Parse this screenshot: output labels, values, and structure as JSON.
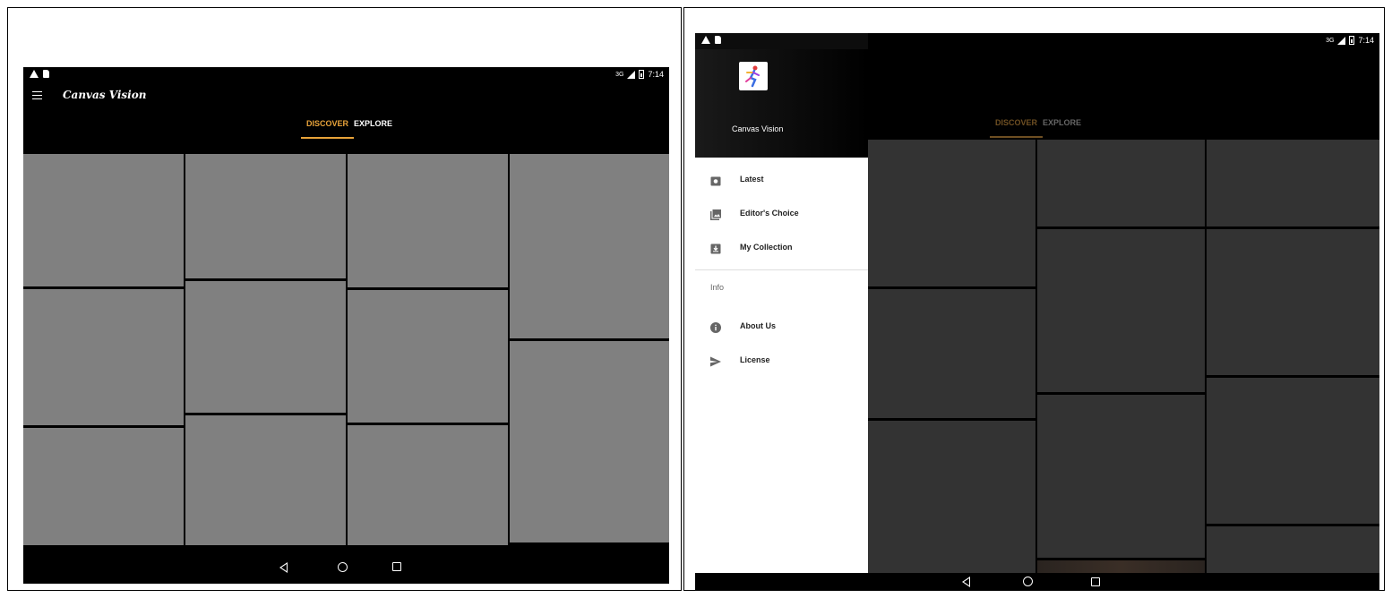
{
  "status": {
    "time": "7:14",
    "network": "3G"
  },
  "app": {
    "title": "Canvas Vision"
  },
  "tabs": [
    {
      "label": "DISCOVER",
      "active": true
    },
    {
      "label": "EXPLORE",
      "active": false
    }
  ],
  "drawer": {
    "title": "Canvas Vision",
    "items": [
      {
        "label": "Latest",
        "icon": "camera-icon"
      },
      {
        "label": "Editor's Choice",
        "icon": "photo-library-icon"
      },
      {
        "label": "My Collection",
        "icon": "download-box-icon"
      }
    ],
    "section_label": "Info",
    "info_items": [
      {
        "label": "About Us",
        "icon": "info-icon"
      },
      {
        "label": "License",
        "icon": "send-icon"
      }
    ]
  },
  "colors": {
    "accent": "#e8a33a",
    "tile_placeholder": "#808080",
    "tile_dimmed": "#333333",
    "background": "#000000"
  }
}
